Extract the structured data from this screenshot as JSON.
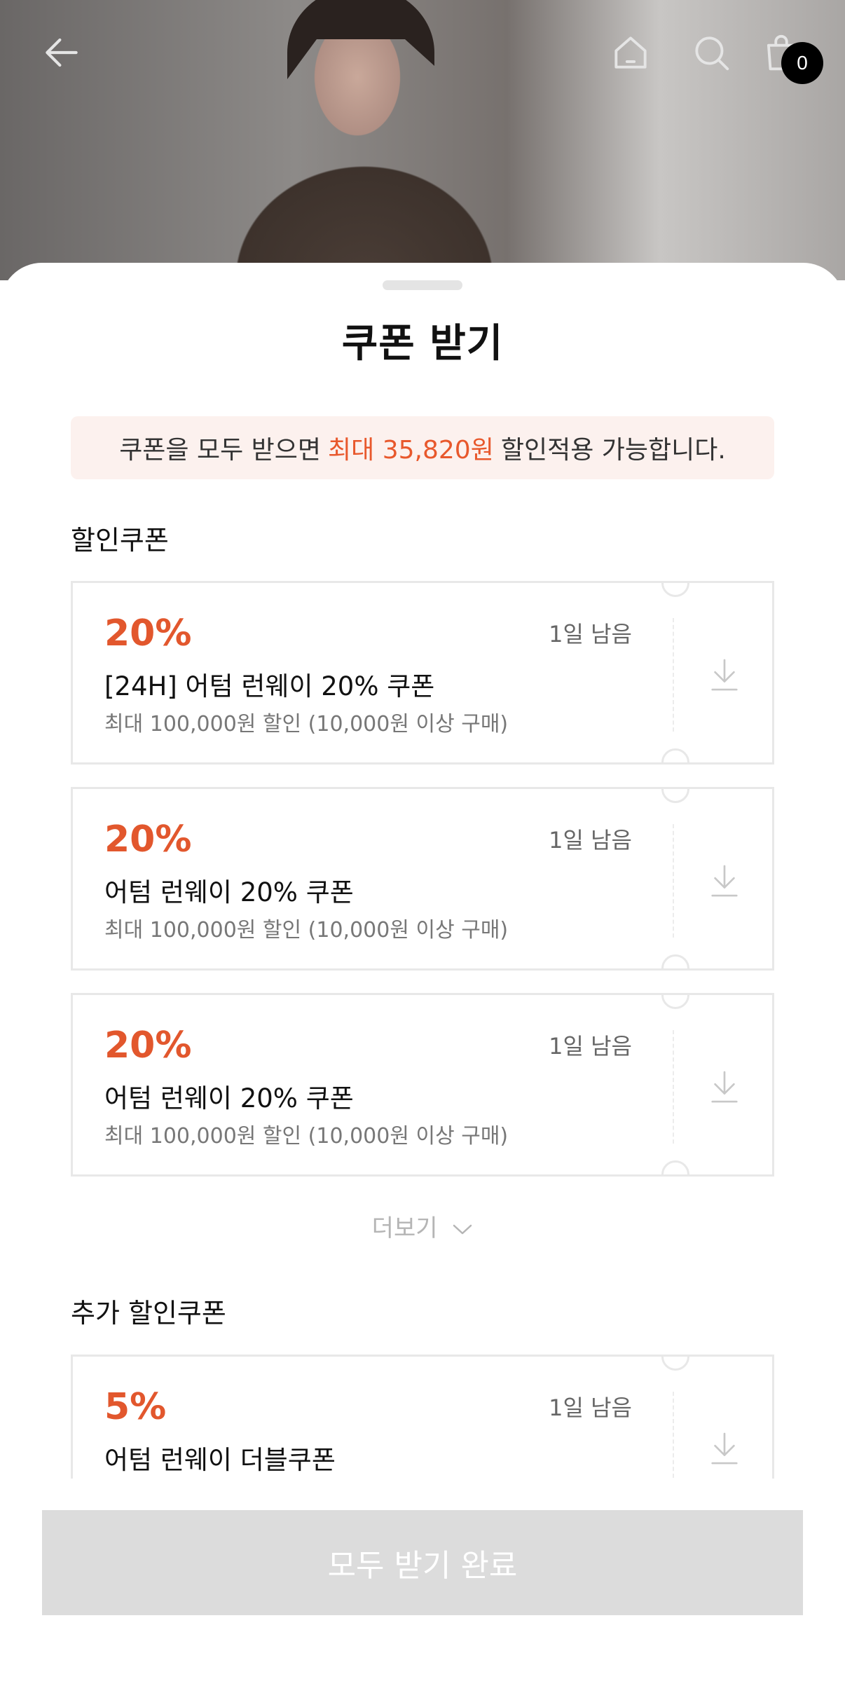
{
  "header": {
    "back_icon": "arrow-left-icon",
    "home_icon": "home-icon",
    "search_icon": "search-icon",
    "cart_icon": "shopping-bag-icon",
    "cart_count": "0"
  },
  "sheet": {
    "title": "쿠폰 받기",
    "notice": {
      "prefix": "쿠폰을 모두 받으면",
      "highlight": "최대 35,820원",
      "suffix": "할인적용 가능합니다.",
      "highlight_color": "#e8582c"
    }
  },
  "sections": {
    "discount": {
      "title": "할인쿠폰",
      "coupons": [
        {
          "percent": "20%",
          "remaining": "1일 남음",
          "name": "[24H] 어텀 런웨이 20% 쿠폰",
          "condition": "최대 100,000원 할인 (10,000원 이상 구매)"
        },
        {
          "percent": "20%",
          "remaining": "1일 남음",
          "name": "어텀 런웨이 20% 쿠폰",
          "condition": "최대 100,000원 할인 (10,000원 이상 구매)"
        },
        {
          "percent": "20%",
          "remaining": "1일 남음",
          "name": "어텀 런웨이 20% 쿠폰",
          "condition": "최대 100,000원 할인 (10,000원 이상 구매)"
        }
      ],
      "more_label": "더보기"
    },
    "extra": {
      "title": "추가 할인쿠폰",
      "coupons": [
        {
          "percent": "5%",
          "remaining": "1일 남음",
          "name": "어텀 런웨이 더블쿠폰"
        }
      ]
    }
  },
  "footer": {
    "button_label": "모두 받기 완료"
  },
  "colors": {
    "accent": "#e2572d",
    "button_disabled": "#dcdcdc"
  }
}
